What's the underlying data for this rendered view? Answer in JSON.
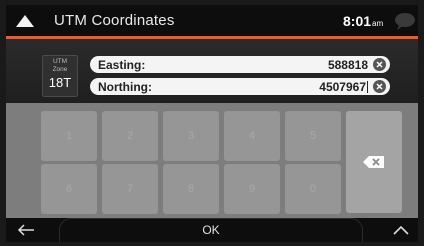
{
  "header": {
    "title": "UTM Coordinates",
    "time": "8:01",
    "time_suffix": "am",
    "up_icon": "up-arrow-icon",
    "message_icon": "message-bubble-icon"
  },
  "utm_zone": {
    "label_line1": "UTM",
    "label_line2": "Zone",
    "value": "18T"
  },
  "fields": {
    "easting": {
      "label": "Easting:",
      "value": "588818"
    },
    "northing": {
      "label": "Northing:",
      "value": "4507967"
    }
  },
  "keypad": {
    "keys": [
      "1",
      "2",
      "3",
      "4",
      "5",
      "6",
      "7",
      "8",
      "9",
      "0"
    ],
    "backspace_icon": "backspace-icon"
  },
  "footer": {
    "ok_label": "OK",
    "back_icon": "back-arrow-icon",
    "more_icon": "chevron-up-icon"
  },
  "colors": {
    "accent": "#f05a28",
    "header_bg": "#0d0d0d",
    "keypad_bg": "#7d7d7d",
    "key_bg": "#969696"
  }
}
